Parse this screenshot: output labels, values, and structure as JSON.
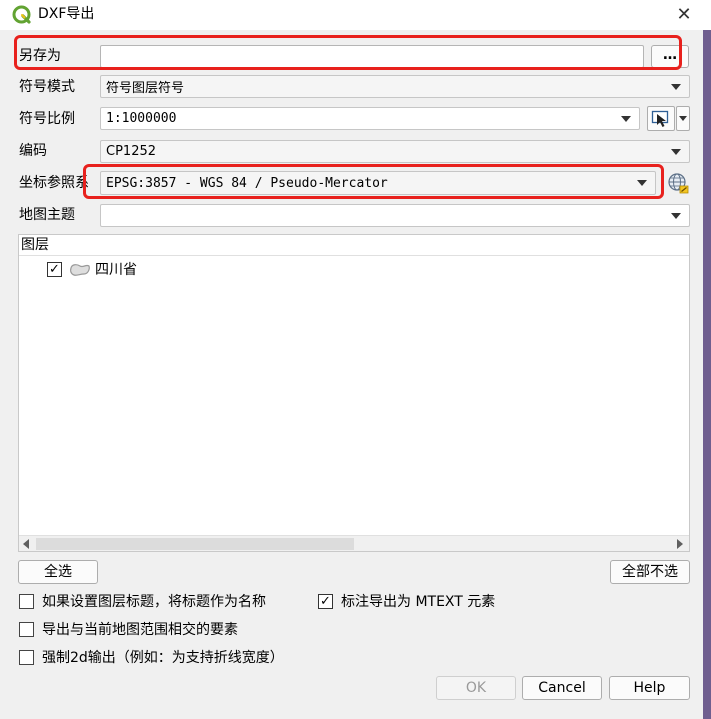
{
  "window": {
    "title": "DXF导出",
    "close_glyph": "✕"
  },
  "form": {
    "save_as_label": "另存为",
    "save_as_value": "",
    "browse_label": "…",
    "symbology_mode_label": "符号模式",
    "symbology_mode_value": "符号图层符号",
    "symbology_scale_label": "符号比例",
    "symbology_scale_value": "1:1000000",
    "encoding_label": "编码",
    "encoding_value": "CP1252",
    "crs_label": "坐标参照系",
    "crs_value": "EPSG:3857 - WGS 84 / Pseudo-Mercator",
    "map_theme_label": "地图主题",
    "map_theme_value": ""
  },
  "layers": {
    "header": "图层",
    "items": [
      {
        "name": "四川省",
        "checked": true
      }
    ]
  },
  "buttons": {
    "select_all": "全选",
    "deselect_all": "全部不选",
    "ok": "OK",
    "cancel": "Cancel",
    "help": "Help"
  },
  "options": {
    "use_title": {
      "label": "如果设置图层标题，将标题作为名称",
      "checked": false
    },
    "export_mtext": {
      "label": "标注导出为 MTEXT 元素",
      "checked": true
    },
    "map_extent": {
      "label": "导出与当前地图范围相交的要素",
      "checked": false
    },
    "force_2d": {
      "label": "强制2d输出（例如：为支持折线宽度）",
      "checked": false
    }
  },
  "icons": {
    "app": "qgis-logo-icon",
    "map_tool": "map-select-icon",
    "crs_select": "globe-crs-icon",
    "layer_type": "polygon-layer-icon"
  },
  "colors": {
    "highlight": "#e8211d",
    "qgis_green": "#62a332"
  }
}
